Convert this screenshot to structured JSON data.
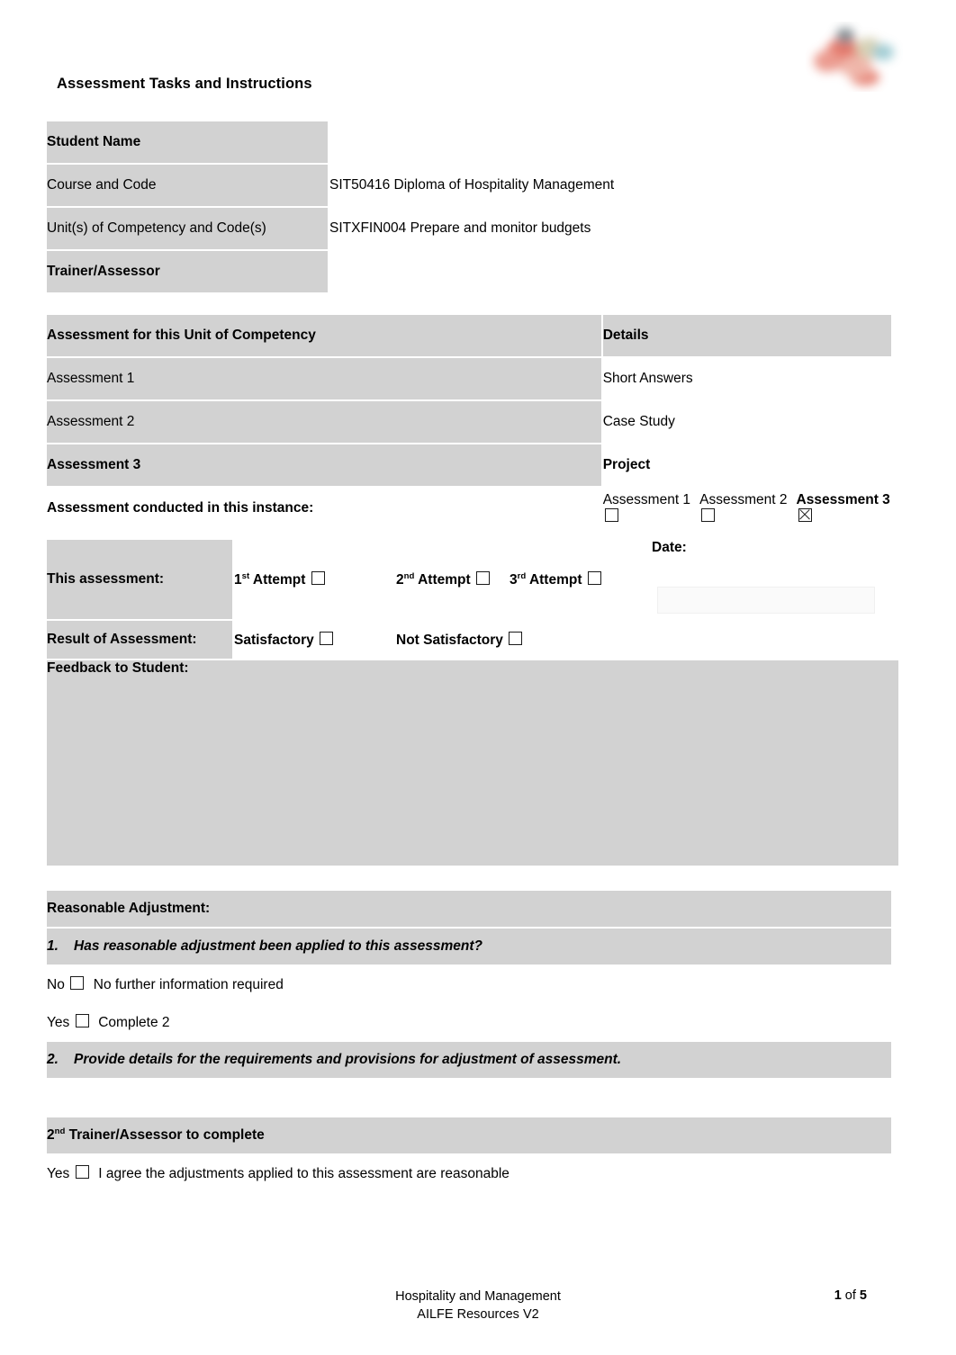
{
  "document": {
    "title": "Assessment Tasks and Instructions",
    "logo": "ailfe-logo"
  },
  "student_details": {
    "rows": [
      {
        "label": "Student Name",
        "value": "",
        "bold": true
      },
      {
        "label": "Course and Code",
        "value": "SIT50416 Diploma of Hospitality Management",
        "bold": false
      },
      {
        "label": "Unit(s) of Competency and Code(s)",
        "value": "SITXFIN004 Prepare and monitor budgets",
        "bold": false
      },
      {
        "label": "Trainer/Assessor",
        "value": "",
        "bold": true
      }
    ]
  },
  "assessments": {
    "header_left": "Assessment for this Unit of Competency",
    "header_right": "Details",
    "rows": [
      {
        "label": "Assessment 1",
        "detail": "Short Answers"
      },
      {
        "label": "Assessment 2",
        "detail": "Case Study"
      },
      {
        "label": "Assessment 3",
        "detail": "Project"
      }
    ],
    "conducted_label": "Assessment conducted in this instance:",
    "conducted_options": [
      {
        "label": "Assessment 1",
        "checked": false
      },
      {
        "label": "Assessment 2",
        "checked": false
      },
      {
        "label": "Assessment 3",
        "checked": true
      }
    ]
  },
  "result_block": {
    "this_assessment_label": "This assessment:",
    "attempts": [
      {
        "num": "1",
        "ord": "st",
        "label": " Attempt",
        "checked": false
      },
      {
        "num": "2",
        "ord": "nd",
        "label": " Attempt",
        "checked": false
      },
      {
        "num": "3",
        "ord": "rd",
        "label": " Attempt",
        "checked": false
      }
    ],
    "date_label": "Date:",
    "date_value": "",
    "result_label": "Result of Assessment:",
    "result_options": [
      {
        "label": "Satisfactory",
        "checked": false
      },
      {
        "label": "Not Satisfactory",
        "checked": false
      }
    ],
    "feedback_label": "Feedback to Student:",
    "feedback_value": ""
  },
  "reasonable_adjustment": {
    "heading": "Reasonable Adjustment:",
    "question_1_num": "1.",
    "question_1": "Has reasonable adjustment been applied to this assessment?",
    "option_no_label": "No",
    "option_no_text": "No further information required",
    "option_no_checked": false,
    "option_yes_label": "Yes",
    "option_yes_text": "Complete 2",
    "option_yes_checked": false,
    "question_2_num": "2.",
    "question_2": "Provide details for the requirements and provisions for adjustment of assessment.",
    "details_value": "",
    "second_assessor_prefix": "2",
    "second_assessor_ord": "nd",
    "second_assessor_heading": " Trainer/Assessor to complete",
    "agree_label": "Yes",
    "agree_text": "I agree the adjustments applied to this assessment are reasonable",
    "agree_checked": false
  },
  "footer": {
    "line1": "Hospitality and Management",
    "line2": "AILFE Resources V2",
    "page_current": "1",
    "page_of": "of",
    "page_total": "5"
  }
}
